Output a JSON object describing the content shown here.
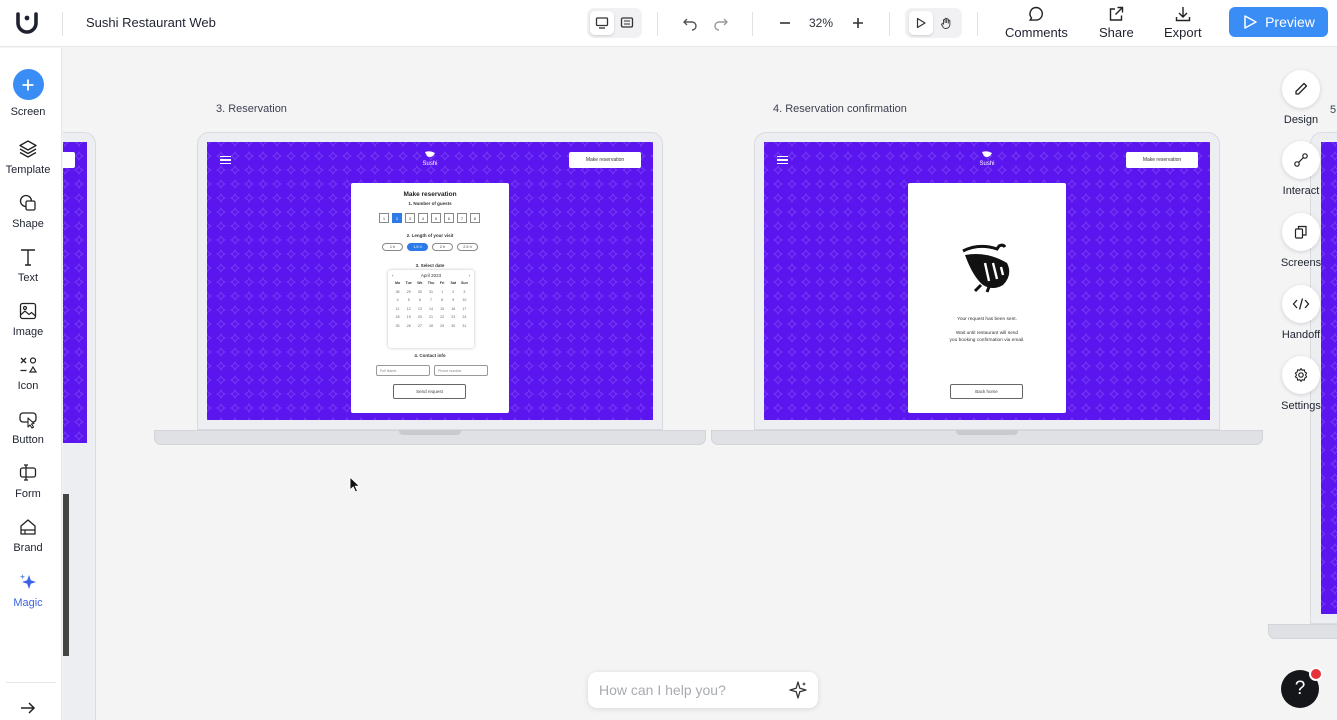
{
  "header": {
    "project_title": "Sushi Restaurant Web",
    "zoom": "32%",
    "actions": [
      {
        "label": "Comments",
        "icon": "comment-icon"
      },
      {
        "label": "Share",
        "icon": "share-icon"
      },
      {
        "label": "Export",
        "icon": "download-icon"
      }
    ],
    "preview_label": "Preview",
    "accent_color": "#3a8df5"
  },
  "left_tools": [
    {
      "label": "Screen",
      "icon": "plus-icon"
    },
    {
      "label": "Template",
      "icon": "layers-icon"
    },
    {
      "label": "Shape",
      "icon": "shape-icon"
    },
    {
      "label": "Text",
      "icon": "text-icon"
    },
    {
      "label": "Image",
      "icon": "image-icon"
    },
    {
      "label": "Icon",
      "icon": "icons-icon"
    },
    {
      "label": "Button",
      "icon": "button-icon"
    },
    {
      "label": "Form",
      "icon": "form-icon"
    },
    {
      "label": "Brand",
      "icon": "brand-icon"
    },
    {
      "label": "Magic",
      "icon": "sparkle-icon"
    }
  ],
  "right_tools": [
    {
      "label": "Design",
      "icon": "pencil-icon"
    },
    {
      "label": "Interact",
      "icon": "interact-icon"
    },
    {
      "label": "Screens",
      "icon": "screens-icon"
    },
    {
      "label": "Handoff",
      "icon": "code-icon"
    },
    {
      "label": "Settings",
      "icon": "gear-icon"
    }
  ],
  "canvas": {
    "next_frame_label": "5.",
    "brand_color": "#5b16ef",
    "frames": [
      {
        "label": "3. Reservation",
        "site_name": "Sushi",
        "nav_button": "Make reservation",
        "modal": {
          "title": "Make reservation",
          "step1": "1. Number of guests",
          "guests": [
            "1",
            "2",
            "3",
            "4",
            "5",
            "6",
            "7",
            "8"
          ],
          "step2": "2. Length of your visit",
          "lengths": [
            "1 h",
            "1.5 h",
            "2 h",
            "2.5 h"
          ],
          "step3": "3. Select date",
          "month": "April 2023",
          "weekdays": [
            "Mo",
            "Tue",
            "We",
            "Thu",
            "Fri",
            "Sat",
            "Sun"
          ],
          "days": [
            "28",
            "29",
            "30",
            "31",
            "1",
            "2",
            "3",
            "4",
            "5",
            "6",
            "7",
            "8",
            "9",
            "10",
            "11",
            "12",
            "13",
            "14",
            "15",
            "16",
            "17",
            "18",
            "19",
            "20",
            "21",
            "22",
            "23",
            "24",
            "25",
            "26",
            "27",
            "28",
            "29",
            "30",
            "31"
          ],
          "step4": "4. Contact info",
          "name_placeholder": "Full Name",
          "phone_placeholder": "Phone number",
          "submit": "Send request"
        }
      },
      {
        "label": "4. Reservation confirmation",
        "site_name": "Sushi",
        "nav_button": "Make reservation",
        "modal": {
          "line1": "Your request has been sent.",
          "line2": "Wait until restaurant will send",
          "line3": "you booking confirmation via email.",
          "button": "Back home"
        }
      }
    ]
  },
  "assistant": {
    "placeholder": "How can I help you?"
  },
  "help": {
    "label": "?"
  }
}
